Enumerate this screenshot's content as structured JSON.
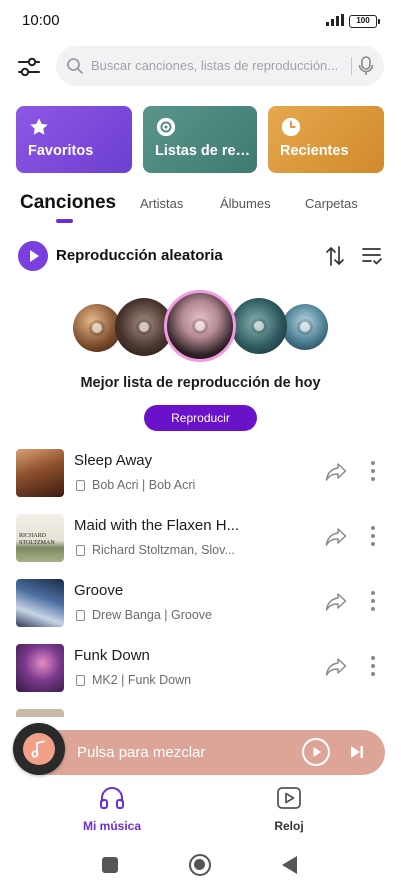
{
  "status_bar": {
    "time": "10:00",
    "battery": "100"
  },
  "search": {
    "placeholder": "Buscar canciones, listas de reproducción..."
  },
  "cards": [
    {
      "label": "Favoritos",
      "color": "#7b4ad9",
      "icon": "star-icon"
    },
    {
      "label": "Listas de repr...",
      "color": "#4e897e",
      "icon": "disc-icon"
    },
    {
      "label": "Recientes",
      "color": "#de9a3f",
      "icon": "clock-icon"
    }
  ],
  "tabs": [
    "Canciones",
    "Artistas",
    "Álbumes",
    "Carpetas"
  ],
  "shuffle": {
    "label": "Reproducción aleatoria"
  },
  "featured": {
    "title": "Mejor lista de reproducción de hoy",
    "button": "Reproducir"
  },
  "songs": [
    {
      "title": "Sleep Away",
      "meta": "Bob Acri | Bob Acri"
    },
    {
      "title": "Maid with the Flaxen H...",
      "meta": "Richard Stoltzman, Slov...",
      "art_text": "RICHARD STOLTZMAN"
    },
    {
      "title": "Groove",
      "meta": "Drew Banga | Groove"
    },
    {
      "title": "Funk Down",
      "meta": "MK2 | Funk Down"
    }
  ],
  "mini_player": {
    "text": "Pulsa para mezclar",
    "color": "#dca597"
  },
  "bottom_nav": [
    {
      "label": "Mi música",
      "icon": "headphones-icon",
      "active": true
    },
    {
      "label": "Reloj",
      "icon": "video-icon",
      "active": false
    }
  ],
  "accent_color": "#6b2fd1"
}
